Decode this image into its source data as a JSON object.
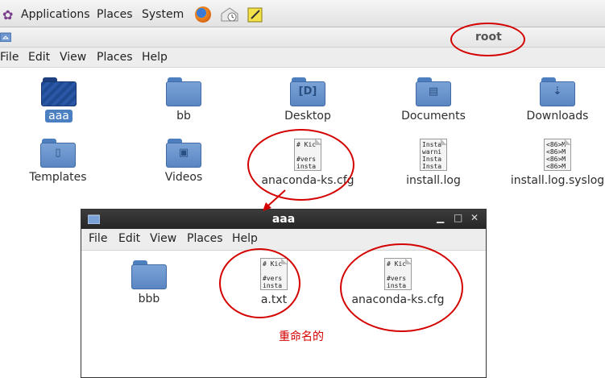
{
  "top_panel": {
    "applications": "Applications",
    "places": "Places",
    "system": "System"
  },
  "bg_window": {
    "title": "root",
    "menu": [
      "File",
      "Edit",
      "View",
      "Places",
      "Help"
    ],
    "items": [
      {
        "label": "aaa",
        "kind": "folder-selected"
      },
      {
        "label": "bb",
        "kind": "folder"
      },
      {
        "label": "Desktop",
        "kind": "folder"
      },
      {
        "label": "Documents",
        "kind": "folder"
      },
      {
        "label": "Downloads",
        "kind": "folder"
      },
      {
        "label": "Templates",
        "kind": "folder"
      },
      {
        "label": "Videos",
        "kind": "folder"
      },
      {
        "label": "anaconda-ks.cfg",
        "kind": "text"
      },
      {
        "label": "install.log",
        "kind": "text"
      },
      {
        "label": "install.log.syslog",
        "kind": "text"
      }
    ]
  },
  "dialog": {
    "title": "aaa",
    "menu": [
      "File",
      "Edit",
      "View",
      "Places",
      "Help"
    ],
    "items": [
      {
        "label": "bbb",
        "kind": "folder"
      },
      {
        "label": "a.txt",
        "kind": "text"
      },
      {
        "label": "anaconda-ks.cfg",
        "kind": "text"
      }
    ]
  },
  "annotation": {
    "note": "重命名的",
    "color": "#d40000"
  },
  "previews": {
    "cfg": "# Kic\n\n#vers\ninsta",
    "log": "Insta\nwarni\nInsta\nInsta",
    "syslog": "<86>M\n<86>M\n<86>M\n<86>M"
  }
}
